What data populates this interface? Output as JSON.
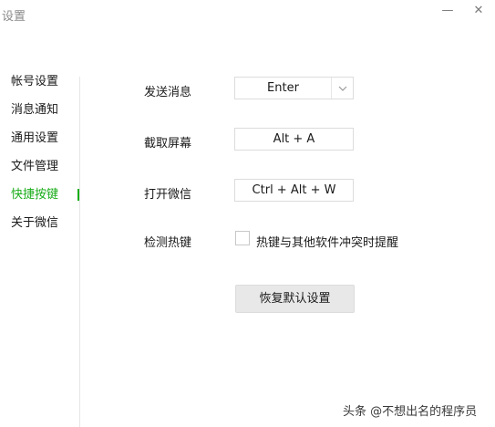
{
  "window": {
    "title": "设置",
    "minimize_glyph": "—",
    "close_glyph": "✕"
  },
  "sidebar": {
    "items": [
      {
        "label": "帐号设置",
        "active": false
      },
      {
        "label": "消息通知",
        "active": false
      },
      {
        "label": "通用设置",
        "active": false
      },
      {
        "label": "文件管理",
        "active": false
      },
      {
        "label": "快捷按键",
        "active": true
      },
      {
        "label": "关于微信",
        "active": false
      }
    ],
    "accent_color": "#1aad19"
  },
  "shortcuts": {
    "send_message": {
      "label": "发送消息",
      "value": "Enter",
      "icon": "chevron-down-icon"
    },
    "screenshot": {
      "label": "截取屏幕",
      "value": "Alt + A"
    },
    "open_wechat": {
      "label": "打开微信",
      "value": "Ctrl + Alt + W"
    },
    "detect_hotkey": {
      "label": "检测热键",
      "checkbox_label": "热键与其他软件冲突时提醒",
      "checked": false
    }
  },
  "restore_button": {
    "label": "恢复默认设置"
  },
  "watermark": {
    "text": "头条 @不想出名的程序员"
  }
}
